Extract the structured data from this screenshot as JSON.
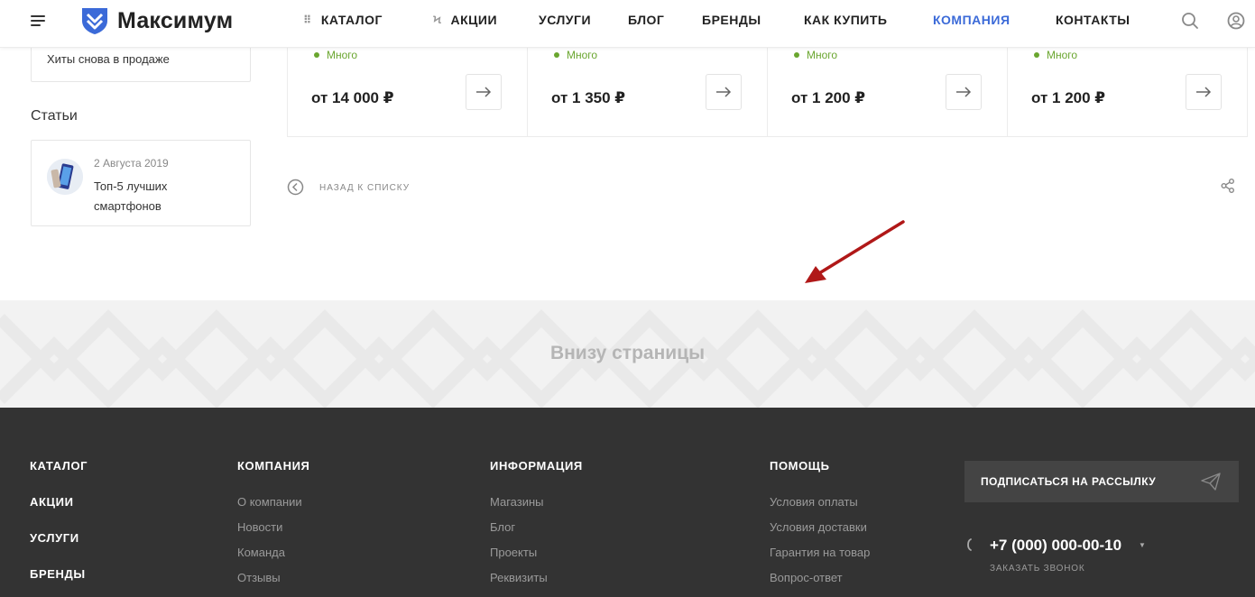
{
  "header": {
    "logo_text": "Максимум",
    "nav": [
      {
        "label": "КАТАЛОГ"
      },
      {
        "label": "АКЦИИ"
      },
      {
        "label": "УСЛУГИ"
      },
      {
        "label": "БЛОГ"
      },
      {
        "label": "БРЕНДЫ"
      },
      {
        "label": "КАК КУПИТЬ"
      },
      {
        "label": "КОМПАНИЯ"
      },
      {
        "label": "КОНТАКТЫ"
      }
    ],
    "active_nav": "КОМПАНИЯ",
    "accent_color": "#3b6ad8"
  },
  "sidebar": {
    "hits_text": "Хиты снова в продаже",
    "articles_title": "Статьи",
    "article": {
      "date": "2 Августа 2019",
      "title": "Топ-5 лучших смартфонов"
    }
  },
  "products": [
    {
      "stock": "Много",
      "price": "от 14 000 ₽"
    },
    {
      "stock": "Много",
      "price": "от 1 350 ₽"
    },
    {
      "stock": "Много",
      "price": "от 1 200 ₽"
    },
    {
      "stock": "Много",
      "price": "от 1 200 ₽"
    }
  ],
  "back_link": "НАЗАД К СПИСКУ",
  "banner": {
    "text": "Внизу страницы",
    "arrow_color": "#b01818"
  },
  "footer": {
    "main_links": [
      "КАТАЛОГ",
      "АКЦИИ",
      "УСЛУГИ",
      "БРЕНДЫ"
    ],
    "company": {
      "heading": "КОМПАНИЯ",
      "links": [
        "О компании",
        "Новости",
        "Команда",
        "Отзывы"
      ]
    },
    "info": {
      "heading": "ИНФОРМАЦИЯ",
      "links": [
        "Магазины",
        "Блог",
        "Проекты",
        "Реквизиты"
      ]
    },
    "help": {
      "heading": "ПОМОЩЬ",
      "links": [
        "Условия оплаты",
        "Условия доставки",
        "Гарантия на товар",
        "Вопрос-ответ"
      ]
    },
    "subscribe_label": "ПОДПИСАТЬСЯ НА РАССЫЛКУ",
    "phone": "+7 (000) 000-00-10",
    "callback_label": "ЗАКАЗАТЬ ЗВОНОК"
  }
}
